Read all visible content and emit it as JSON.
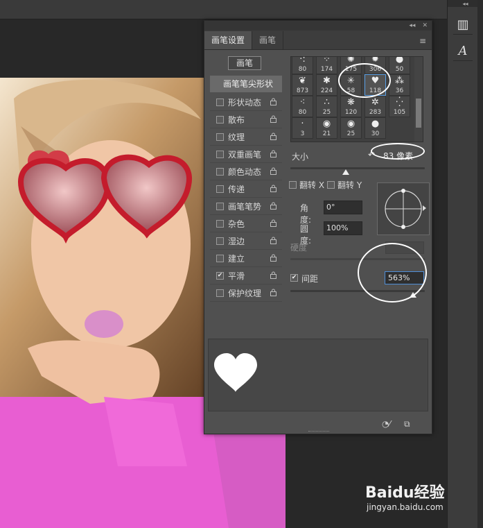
{
  "panel": {
    "tabs": [
      "画笔设置",
      "画笔"
    ],
    "brush_button": "画笔",
    "sidebar_header": "画笔笔尖形状",
    "sidebar_items": [
      {
        "label": "形状动态",
        "checked": false
      },
      {
        "label": "散布",
        "checked": false
      },
      {
        "label": "纹理",
        "checked": false
      },
      {
        "label": "双重画笔",
        "checked": false
      },
      {
        "label": "颜色动态",
        "checked": false
      },
      {
        "label": "传递",
        "checked": false
      },
      {
        "label": "画笔笔势",
        "checked": false
      },
      {
        "label": "杂色",
        "checked": false
      },
      {
        "label": "湿边",
        "checked": false
      },
      {
        "label": "建立",
        "checked": false
      },
      {
        "label": "平滑",
        "checked": true
      },
      {
        "label": "保护纹理",
        "checked": false
      }
    ],
    "brush_tips": [
      {
        "num": "80",
        "glyph": "·:"
      },
      {
        "num": "174",
        "glyph": "⁘"
      },
      {
        "num": "175",
        "glyph": "✺"
      },
      {
        "num": "306",
        "glyph": "✹"
      },
      {
        "num": "50",
        "glyph": "●"
      },
      {
        "num": "873",
        "glyph": "❦"
      },
      {
        "num": "224",
        "glyph": "✱"
      },
      {
        "num": "58",
        "glyph": "✳"
      },
      {
        "num": "118",
        "glyph": "♥"
      },
      {
        "num": "36",
        "glyph": "⁂"
      },
      {
        "num": "80",
        "glyph": "⁖"
      },
      {
        "num": "25",
        "glyph": "∴"
      },
      {
        "num": "120",
        "glyph": "❋"
      },
      {
        "num": "283",
        "glyph": "✲"
      },
      {
        "num": "105",
        "glyph": "⁛"
      },
      {
        "num": "3",
        "glyph": "·"
      },
      {
        "num": "21",
        "glyph": "◉"
      },
      {
        "num": "25",
        "glyph": "◉"
      },
      {
        "num": "30",
        "glyph": "●"
      }
    ],
    "size": {
      "label": "大小",
      "value": "83 像素"
    },
    "flip_x": "翻转 X",
    "flip_y": "翻转 Y",
    "angle": {
      "label": "角度:",
      "value": "0°"
    },
    "roundness": {
      "label": "圆度:",
      "value": "100%"
    },
    "hardness": {
      "label": "硬度"
    },
    "spacing": {
      "label": "间距",
      "value": "563%",
      "checked": true
    }
  },
  "watermark": {
    "logo": "Baidu经验",
    "url": "jingyan.baidu.com"
  }
}
